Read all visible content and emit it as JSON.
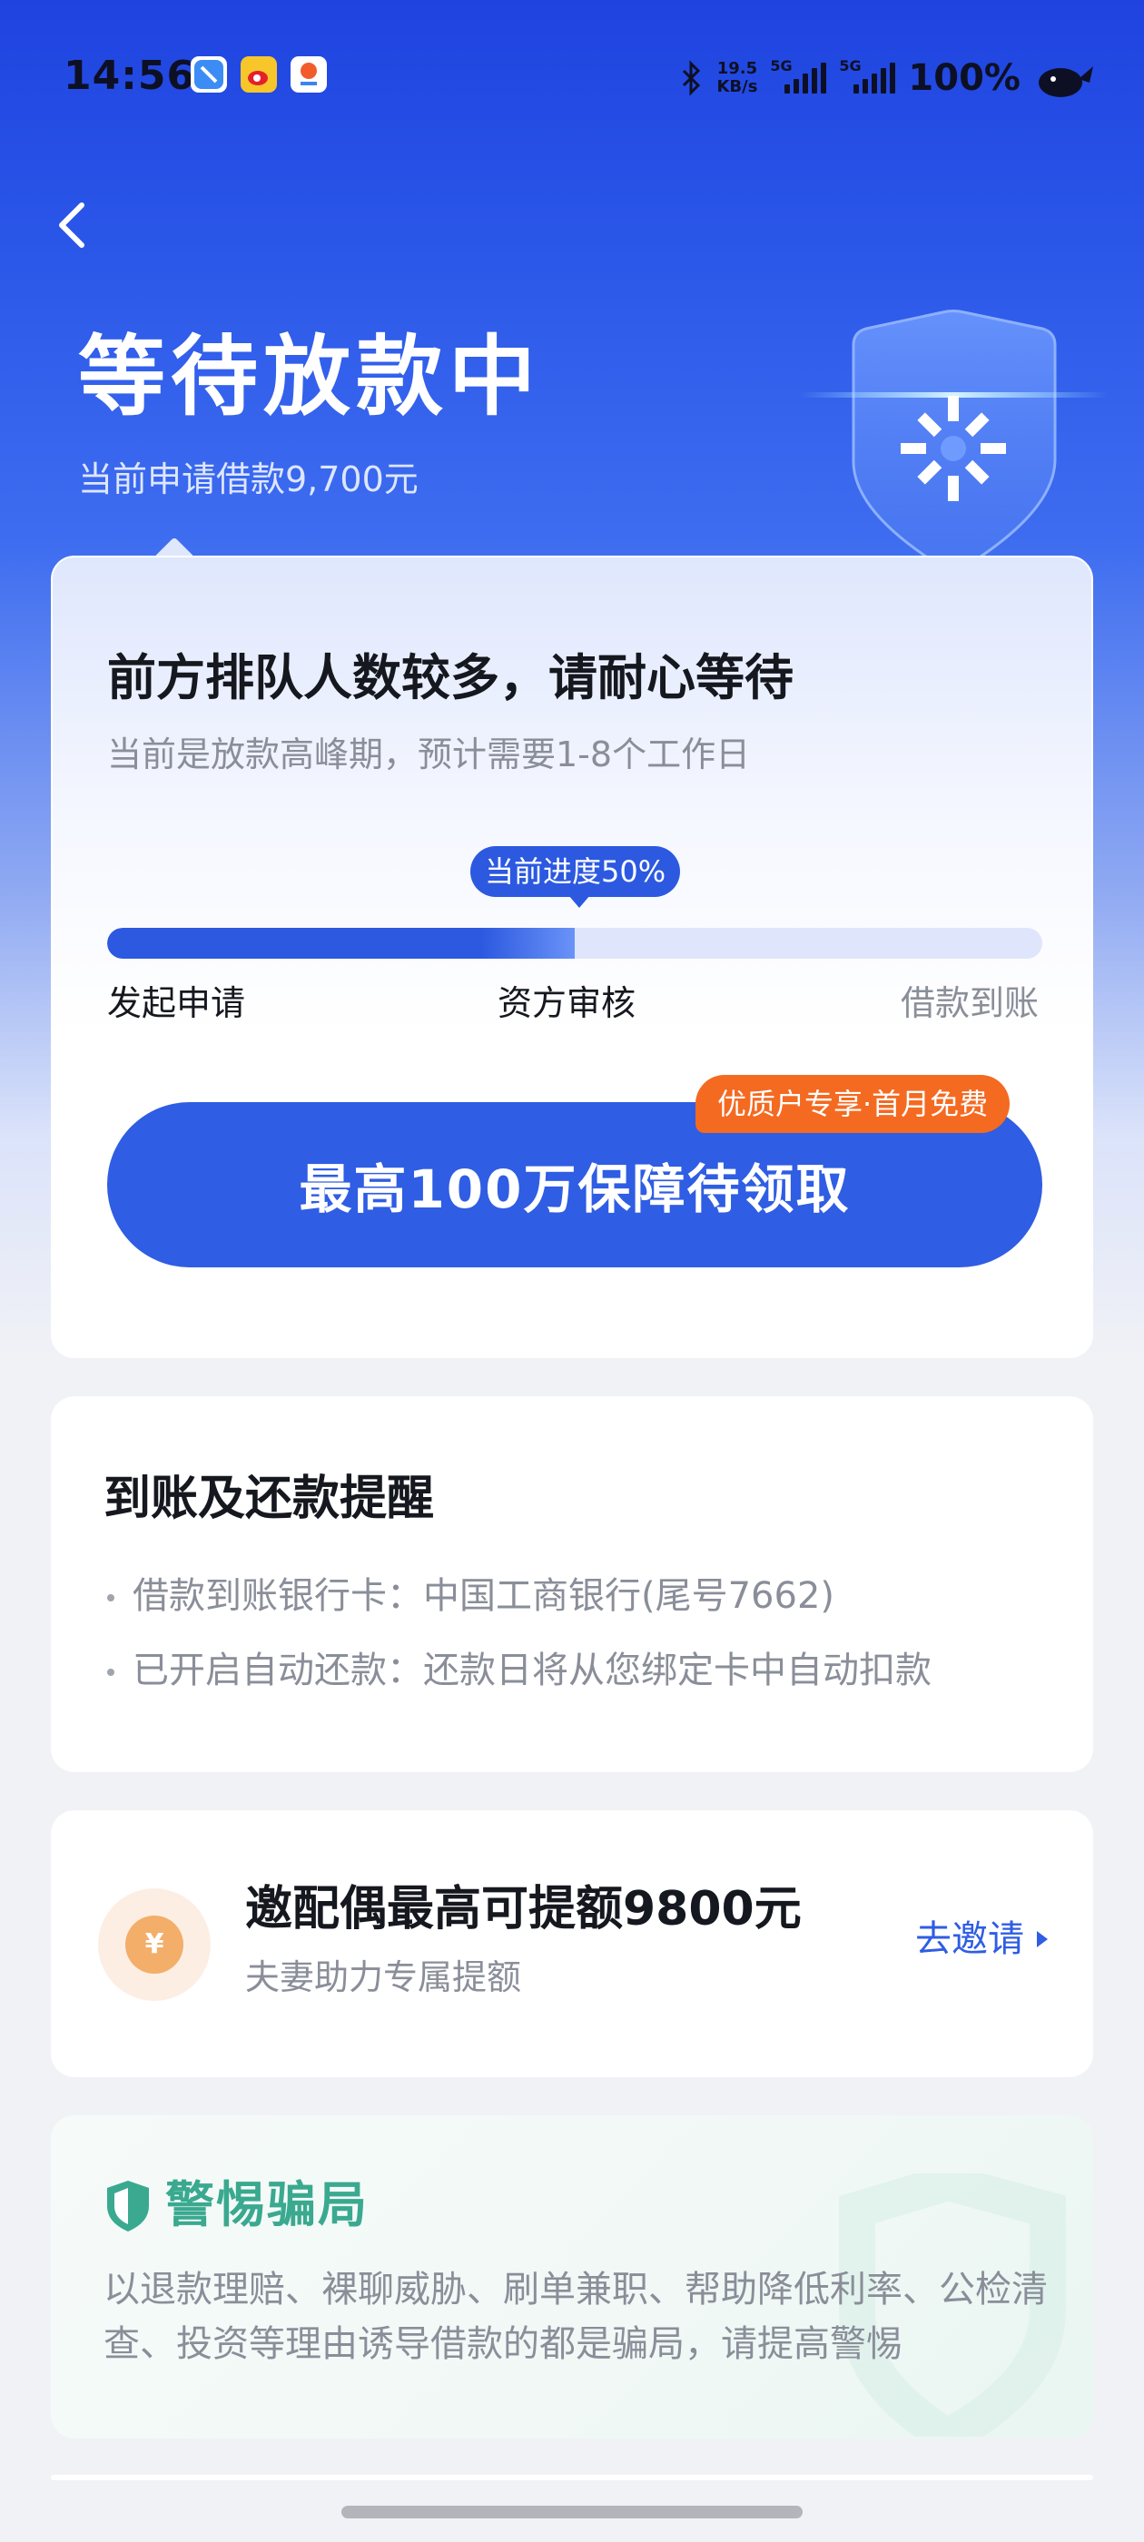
{
  "status_bar": {
    "time": "14:56",
    "net_speed_value": "19.5",
    "net_speed_unit": "KB/s",
    "sim1_label": "5G",
    "sim2_label": "5G",
    "battery": "100%"
  },
  "header": {
    "title": "等待放款中",
    "subtitle": "当前申请借款9,700元"
  },
  "progress_card": {
    "title": "前方排队人数较多，请耐心等待",
    "subtitle": "当前是放款高峰期，预计需要1-8个工作日",
    "progress_label": "当前进度50%",
    "progress": 0.5,
    "steps": [
      {
        "label": "发起申请",
        "state": "done"
      },
      {
        "label": "资方审核",
        "state": "current"
      },
      {
        "label": "借款到账",
        "state": "pending"
      }
    ],
    "cta_label": "最高100万保障待领取",
    "cta_badge": "优质户专享·首月免费"
  },
  "reminder_card": {
    "title": "到账及还款提醒",
    "items": [
      "借款到账银行卡：中国工商银行(尾号7662)",
      "已开启自动还款：还款日将从您绑定卡中自动扣款"
    ]
  },
  "invite_card": {
    "coin_symbol": "¥",
    "title": "邀配偶最高可提额9800元",
    "subtitle": "夫妻助力专属提额",
    "link_label": "去邀请"
  },
  "warning_card": {
    "title": "警惕骗局",
    "text": "以退款理赔、裸聊威胁、刷单兼职、帮助降低利率、公检清查、投资等理由诱导借款的都是骗局，请提高警惕"
  },
  "colors": {
    "primary": "#2f5de3",
    "badge_orange": "#f46a21",
    "warning_green": "#3aa98f",
    "muted_text": "#8a8e99"
  }
}
